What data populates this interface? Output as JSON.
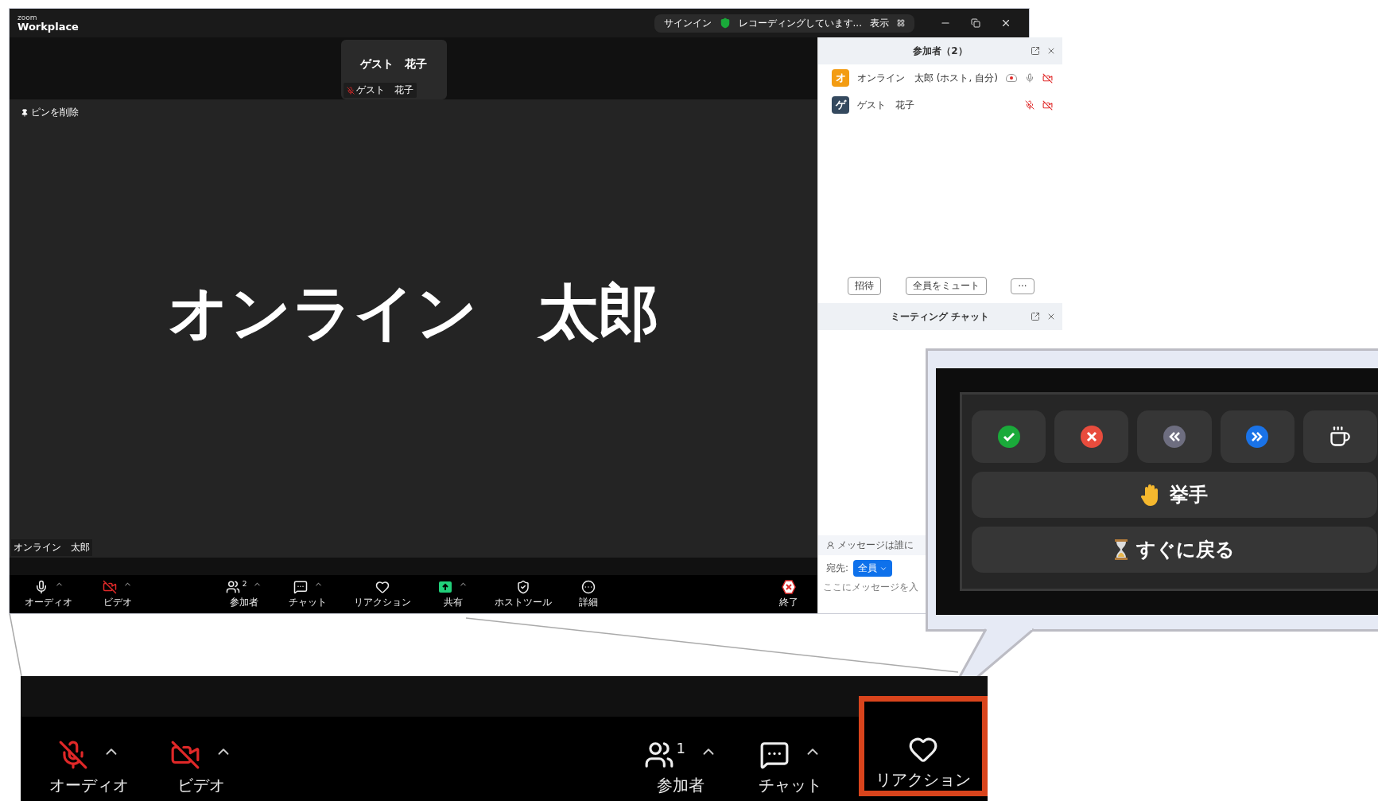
{
  "window": {
    "logo_top": "zoom",
    "logo_bottom": "Workplace",
    "signin": "サインイン",
    "recording": "レコーディングしています...",
    "view": "表示"
  },
  "video": {
    "thumbnail_name": "ゲスト　花子",
    "thumbnail_tag": "ゲスト　花子",
    "thumbnail_muted": true,
    "unpin": "ピンを削除",
    "speaker_name": "オンライン　太郎",
    "name_tag": "オンライン　太郎"
  },
  "toolbar": [
    {
      "kind": "audio",
      "label": "オーディオ",
      "caret": true,
      "off": false
    },
    {
      "kind": "video",
      "label": "ビデオ",
      "caret": true,
      "off": true
    },
    {
      "kind": "participants",
      "label": "参加者",
      "count": "2",
      "caret": true
    },
    {
      "kind": "chat",
      "label": "チャット",
      "caret": true
    },
    {
      "kind": "reaction",
      "label": "リアクション",
      "caret": false
    },
    {
      "kind": "share",
      "label": "共有",
      "caret": true
    },
    {
      "kind": "host_tools",
      "label": "ホストツール",
      "caret": false
    },
    {
      "kind": "details",
      "label": "詳細",
      "caret": false
    },
    {
      "kind": "end",
      "label": "終了",
      "caret": false
    }
  ],
  "participants_panel": {
    "title": "参加者（2）",
    "members": [
      {
        "initial": "オ",
        "name": "オンライン　太郎 (ホスト, 自分)",
        "color": "#f39c12",
        "recording": true,
        "muted": false,
        "video_off": true
      },
      {
        "initial": "ゲ",
        "name": "ゲスト　花子",
        "color": "#34495e",
        "recording": false,
        "muted": true,
        "video_off": true
      }
    ],
    "buttons": [
      "招待",
      "全員をミュート",
      "···"
    ]
  },
  "chat_panel": {
    "title": "ミーティング チャット",
    "notice": "メッセージは誰に",
    "to_label": "宛先:",
    "recipient": "全員",
    "placeholder": "ここにメッセージを入"
  },
  "reactions_popup": {
    "emoji": [
      {
        "kind": "yes",
        "color": "#1aaa3a"
      },
      {
        "kind": "no",
        "color": "#e84c3d"
      },
      {
        "kind": "slower",
        "color": "#6e6e80"
      },
      {
        "kind": "faster",
        "color": "#1a73e8"
      },
      {
        "kind": "coffee",
        "color": "#ffffff"
      }
    ],
    "raise_hand": "挙手",
    "be_right_back": "すぐに戻る"
  },
  "zoomed_toolbar": [
    {
      "kind": "audio",
      "label": "オーディオ",
      "caret": true,
      "off": true,
      "highlighted": false
    },
    {
      "kind": "video",
      "label": "ビデオ",
      "caret": true,
      "off": true,
      "highlighted": false
    },
    {
      "kind": "participants",
      "label": "参加者",
      "count": "1",
      "caret": true,
      "highlighted": false
    },
    {
      "kind": "chat",
      "label": "チャット",
      "caret": true,
      "highlighted": false
    },
    {
      "kind": "reaction",
      "label": "リアクション",
      "caret": false,
      "highlighted": true
    }
  ]
}
